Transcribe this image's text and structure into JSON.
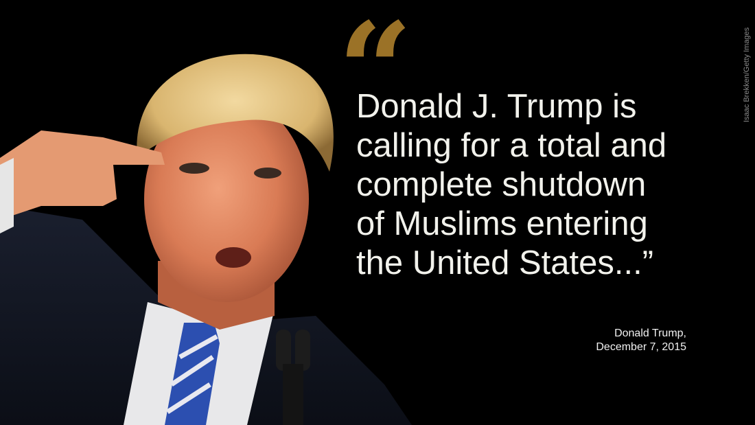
{
  "quote": {
    "open_mark": "“",
    "lines": [
      "Donald J. Trump is",
      "calling for a total and",
      "complete shutdown",
      "of Muslims entering",
      "the United States...”"
    ]
  },
  "attribution": {
    "name": "Donald Trump,",
    "date": "December 7, 2015"
  },
  "photo_credit": "Isaac Brekken/Getty Images",
  "colors": {
    "background": "#000000",
    "quote_mark": "#9b7227",
    "quote_text": "#f2f2ec"
  }
}
